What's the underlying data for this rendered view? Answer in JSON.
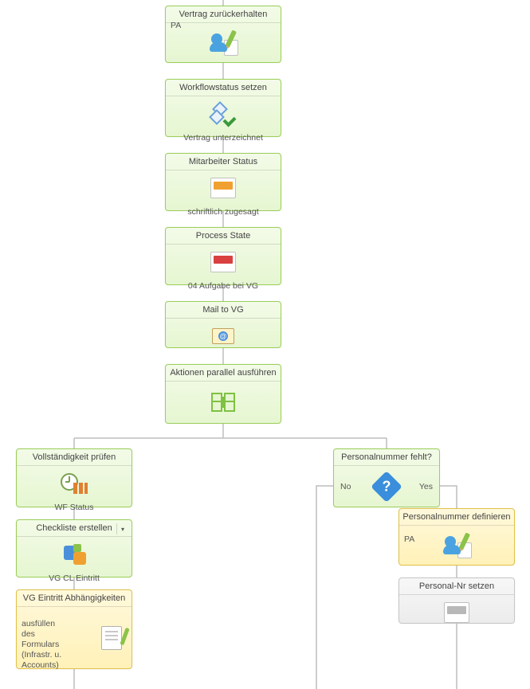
{
  "nodes": {
    "n1": {
      "title": "Vertrag zurückerhalten",
      "role": "PA"
    },
    "n2": {
      "title": "Workflowstatus setzen",
      "footer": "Vertrag unterzeichnet"
    },
    "n3": {
      "title": "Mitarbeiter Status",
      "footer": "schriftlich zugesagt"
    },
    "n4": {
      "title": "Process State",
      "footer": "04 Aufgabe bei VG"
    },
    "n5": {
      "title": "Mail to VG"
    },
    "n6": {
      "title": "Aktionen parallel ausführen"
    },
    "n7": {
      "title": "Vollständigkeit prüfen",
      "footer": "WF Status"
    },
    "n8": {
      "title": "Checkliste erstellen",
      "footer": "VG CL Eintritt"
    },
    "n9": {
      "title": "VG Eintritt Abhängigkeiten",
      "side": "ausfüllen des Formulars (Infrastr. u. Accounts)"
    },
    "n10": {
      "title": "Personalnummer fehlt?",
      "left": "No",
      "right": "Yes"
    },
    "n11": {
      "title": "Personalnummer definieren",
      "role": "PA"
    },
    "n12": {
      "title": "Personal-Nr setzen"
    }
  }
}
